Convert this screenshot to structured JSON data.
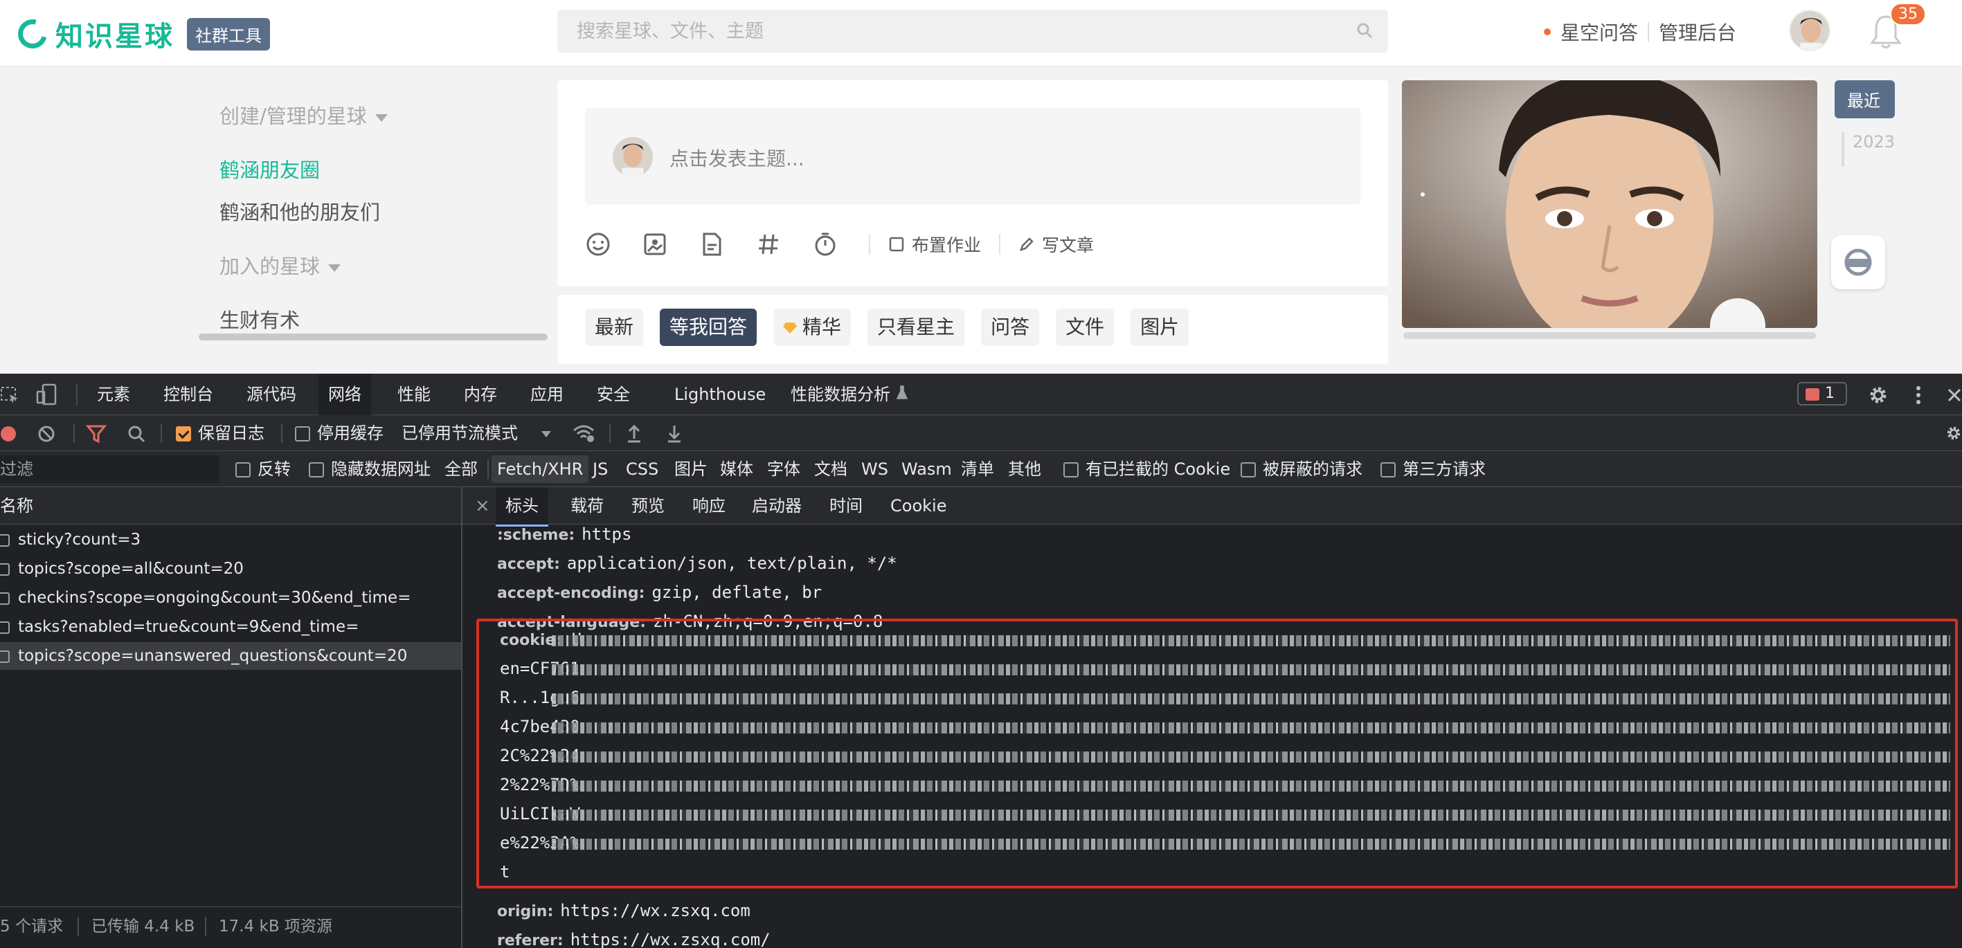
{
  "site": {
    "logo_text": "知识星球",
    "tag": "社群工具",
    "search_placeholder": "搜索星球、文件、主题",
    "links": [
      "星空问答",
      "管理后台"
    ],
    "notifications": "35"
  },
  "left": {
    "created_header": "创建/管理的星球",
    "created_items": [
      "鹤涵朋友圈",
      "鹤涵和他的朋友们"
    ],
    "joined_header": "加入的星球",
    "joined_items": [
      "生财有术"
    ]
  },
  "composer": {
    "placeholder": "点击发表主题...",
    "tool_homework": "布置作业",
    "tool_article": "写文章"
  },
  "tabs": [
    "最新",
    "等我回答",
    "精华",
    "只看星主",
    "问答",
    "文件",
    "图片"
  ],
  "side": {
    "recent": "最近",
    "year": "2023"
  },
  "devtools": {
    "panels": [
      "元素",
      "控制台",
      "源代码",
      "网络",
      "性能",
      "内存",
      "应用",
      "安全",
      "Lighthouse",
      "性能数据分析"
    ],
    "active_panel": "网络",
    "error_count": "1",
    "toolbar1": {
      "preserve_log": "保留日志",
      "disable_cache": "停用缓存",
      "throttle": "已停用节流模式"
    },
    "toolbar2": {
      "filter_placeholder": "过滤",
      "invert": "反转",
      "hide_data_urls": "隐藏数据网址",
      "types": [
        "全部",
        "Fetch/XHR",
        "JS",
        "CSS",
        "图片",
        "媒体",
        "字体",
        "文档",
        "WS",
        "Wasm",
        "清单",
        "其他"
      ],
      "active_type": "Fetch/XHR",
      "blocked_cookies": "有已拦截的 Cookie",
      "blocked_requests": "被屏蔽的请求",
      "third_party": "第三方请求"
    },
    "name_column": "名称",
    "requests": [
      "sticky?count=3",
      "topics?scope=all&count=20",
      "checkins?scope=ongoing&count=30&end_time=",
      "tasks?enabled=true&count=9&end_time=",
      "topics?scope=unanswered_questions&count=20"
    ],
    "status": {
      "requests": "5 个请求",
      "transferred": "已传输 4.4 kB",
      "resources": "17.4 kB 项资源"
    },
    "detail_tabs": [
      "标头",
      "载荷",
      "预览",
      "响应",
      "启动器",
      "时间",
      "Cookie"
    ],
    "headers": [
      {
        "k": ":scheme:",
        "v": "https"
      },
      {
        "k": "accept:",
        "v": "application/json, text/plain, */*"
      },
      {
        "k": "accept-encoding:",
        "v": "gzip, deflate, br"
      },
      {
        "k": "accept-language:",
        "v": "zh-CN,zh;q=0.9,en;q=0.8"
      }
    ],
    "cookie_key": "cookie:",
    "cookie_lines": [
      "U",
      "en=CF761",
      "R...1gu6",
      "4c7be430",
      "2C%22%24",
      "2%22%7D%",
      "UiLCIkaW",
      "e%22%3A%",
      "t"
    ],
    "after_headers": [
      {
        "k": "origin:",
        "v": "https://wx.zsxq.com"
      },
      {
        "k": "referer:",
        "v": "https://wx.zsxq.com/"
      }
    ]
  }
}
